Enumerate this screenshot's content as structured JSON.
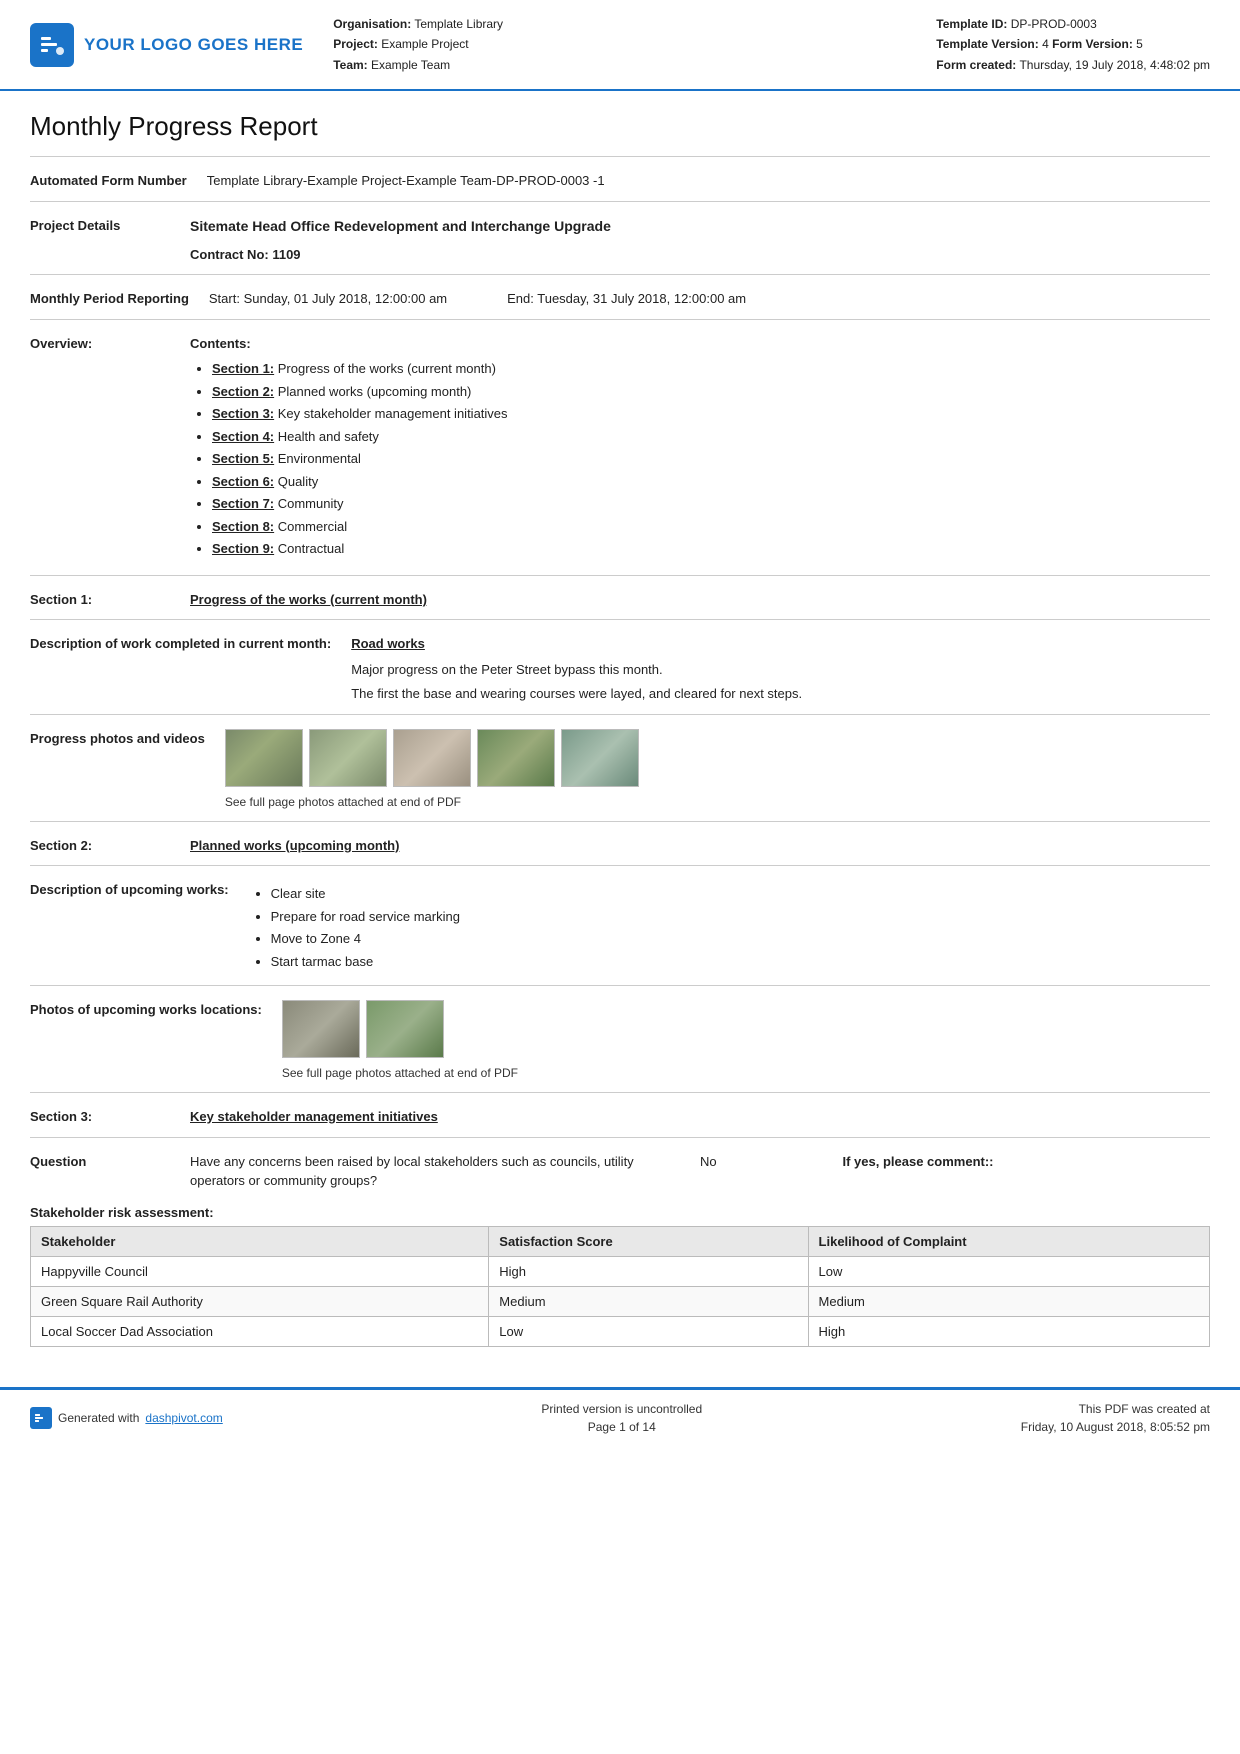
{
  "header": {
    "logo_text": "YOUR LOGO GOES HERE",
    "org_label": "Organisation:",
    "org_value": "Template Library",
    "project_label": "Project:",
    "project_value": "Example Project",
    "team_label": "Team:",
    "team_value": "Example Team",
    "template_id_label": "Template ID:",
    "template_id_value": "DP-PROD-0003",
    "template_version_label": "Template Version:",
    "template_version_value": "4",
    "form_version_label": "Form Version:",
    "form_version_value": "5",
    "form_created_label": "Form created:",
    "form_created_value": "Thursday, 19 July 2018, 4:48:02 pm"
  },
  "page_title": "Monthly Progress Report",
  "automated_form": {
    "label": "Automated Form Number",
    "value": "Template Library-Example Project-Example Team-DP-PROD-0003   -1"
  },
  "project_details": {
    "label": "Project Details",
    "line1": "Sitemate Head Office Redevelopment and Interchange Upgrade",
    "line2": "Contract No: 1109"
  },
  "monthly_period": {
    "label": "Monthly Period Reporting",
    "start": "Start: Sunday, 01 July 2018, 12:00:00 am",
    "end": "End: Tuesday, 31 July 2018, 12:00:00 am"
  },
  "overview": {
    "label": "Overview:",
    "contents_label": "Contents:",
    "items": [
      {
        "link": "Section 1:",
        "text": " Progress of the works (current month)"
      },
      {
        "link": "Section 2:",
        "text": " Planned works (upcoming month)"
      },
      {
        "link": "Section 3:",
        "text": " Key stakeholder management initiatives"
      },
      {
        "link": "Section 4:",
        "text": " Health and safety"
      },
      {
        "link": "Section 5:",
        "text": " Environmental"
      },
      {
        "link": "Section 6:",
        "text": " Quality"
      },
      {
        "link": "Section 7:",
        "text": " Community"
      },
      {
        "link": "Section 8:",
        "text": " Commercial"
      },
      {
        "link": "Section 9:",
        "text": " Contractual"
      }
    ]
  },
  "section1": {
    "label": "Section 1:",
    "heading": "Progress of the works (current month)"
  },
  "description_of_work": {
    "label": "Description of work completed in current month:",
    "title": "Road works",
    "line1": "Major progress on the Peter Street bypass this month.",
    "line2": "The first the base and wearing courses were layed, and cleared for next steps."
  },
  "progress_photos": {
    "label": "Progress photos and videos",
    "caption": "See full page photos attached at end of PDF"
  },
  "section2": {
    "label": "Section 2:",
    "heading": "Planned works (upcoming month)"
  },
  "upcoming_works": {
    "label": "Description of upcoming works:",
    "items": [
      "Clear site",
      "Prepare for road service marking",
      "Move to Zone 4",
      "Start tarmac base"
    ]
  },
  "photos_upcoming": {
    "label": "Photos of upcoming works locations:",
    "caption": "See full page photos attached at end of PDF"
  },
  "section3": {
    "label": "Section 3:",
    "heading": "Key stakeholder management initiatives"
  },
  "question": {
    "label": "Question",
    "text": "Have any concerns been raised by local stakeholders such as councils, utility operators or community groups?",
    "answer": "No",
    "comment_label": "If yes, please comment::"
  },
  "stakeholder": {
    "label": "Stakeholder risk assessment:",
    "columns": [
      "Stakeholder",
      "Satisfaction Score",
      "Likelihood of Complaint"
    ],
    "rows": [
      [
        "Happyville Council",
        "High",
        "Low"
      ],
      [
        "Green Square Rail Authority",
        "Medium",
        "Medium"
      ],
      [
        "Local Soccer Dad Association",
        "Low",
        "High"
      ]
    ]
  },
  "footer": {
    "generated_text": "Generated with",
    "link_text": "dashpivot.com",
    "center_line1": "Printed version is uncontrolled",
    "center_line2": "Page 1 of 14",
    "right_line1": "This PDF was created at",
    "right_line2": "Friday, 10 August 2018, 8:05:52 pm"
  }
}
